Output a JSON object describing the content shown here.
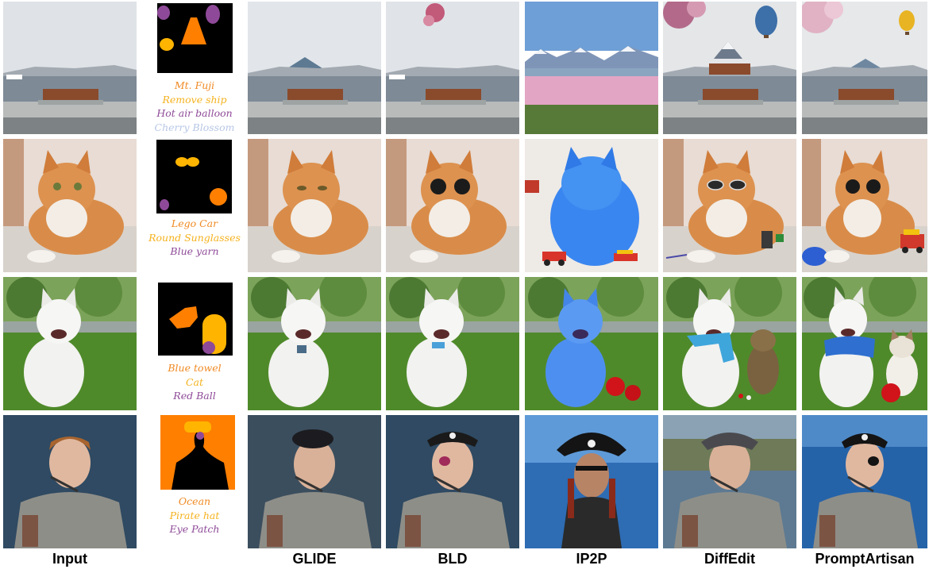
{
  "columns": {
    "input": "Input",
    "glide": "GLIDE",
    "bld": "BLD",
    "ip2p": "IP2P",
    "diffedit": "DiffEdit",
    "promptartisan": "PromptArtisan"
  },
  "rows": [
    {
      "scene": "lakeside-bench",
      "prompts": [
        {
          "text": "Mt. Fuji",
          "color": "#f08a24"
        },
        {
          "text": "Remove ship",
          "color": "#f5b21e"
        },
        {
          "text": "Hot air balloon",
          "color": "#8e4a98"
        },
        {
          "text": "Cherry Blossom",
          "color": "#b7c7e6"
        }
      ]
    },
    {
      "scene": "orange-cat",
      "prompts": [
        {
          "text": "Lego Car",
          "color": "#f08a24"
        },
        {
          "text": "Round Sunglasses",
          "color": "#f5b21e"
        },
        {
          "text": "Blue yarn",
          "color": "#8e4a98"
        }
      ]
    },
    {
      "scene": "white-dog",
      "prompts": [
        {
          "text": "Blue towel",
          "color": "#f08a24"
        },
        {
          "text": "Cat",
          "color": "#f5b21e"
        },
        {
          "text": "Red Ball",
          "color": "#8e4a98"
        }
      ]
    },
    {
      "scene": "man-portrait",
      "prompts": [
        {
          "text": "Ocean",
          "color": "#f08a24"
        },
        {
          "text": "Pirate hat",
          "color": "#f5b21e"
        },
        {
          "text": "Eye Patch",
          "color": "#8e4a98"
        }
      ]
    }
  ],
  "mask_colors": {
    "first": "#ff7f00",
    "second": "#ffb400",
    "third": "#8e4a98",
    "background": "#000000"
  }
}
